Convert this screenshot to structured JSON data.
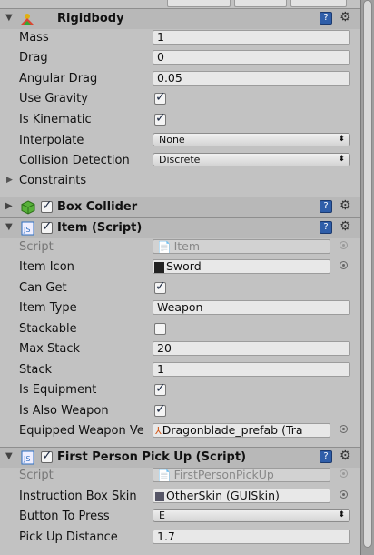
{
  "rigidbody": {
    "title": "Rigidbody",
    "mass_label": "Mass",
    "mass": "1",
    "drag_label": "Drag",
    "drag": "0",
    "angular_drag_label": "Angular Drag",
    "angular_drag": "0.05",
    "use_gravity_label": "Use Gravity",
    "use_gravity": true,
    "is_kinematic_label": "Is Kinematic",
    "is_kinematic": true,
    "interpolate_label": "Interpolate",
    "interpolate": "None",
    "collision_detection_label": "Collision Detection",
    "collision_detection": "Discrete",
    "constraints_label": "Constraints"
  },
  "box_collider": {
    "title": "Box Collider",
    "enabled": true
  },
  "item_script": {
    "title": "Item (Script)",
    "enabled": true,
    "script_label": "Script",
    "script": "Item",
    "item_icon_label": "Item Icon",
    "item_icon": "Sword",
    "can_get_label": "Can Get",
    "can_get": true,
    "item_type_label": "Item Type",
    "item_type": "Weapon",
    "stackable_label": "Stackable",
    "stackable": false,
    "max_stack_label": "Max Stack",
    "max_stack": "20",
    "stack_label": "Stack",
    "stack": "1",
    "is_equipment_label": "Is Equipment",
    "is_equipment": true,
    "is_also_weapon_label": "Is Also Weapon",
    "is_also_weapon": true,
    "equipped_weapon_label": "Equipped Weapon Ve",
    "equipped_weapon": "Dragonblade_prefab (Tra"
  },
  "pickup_script": {
    "title": "First Person Pick Up (Script)",
    "enabled": true,
    "script_label": "Script",
    "script": "FirstPersonPickUp",
    "instruction_skin_label": "Instruction Box Skin",
    "instruction_skin": "OtherSkin (GUISkin)",
    "button_label": "Button To Press",
    "button": "E",
    "distance_label": "Pick Up Distance",
    "distance": "1.7"
  },
  "icons": {
    "fold": "fold-down-icon",
    "help": "help-book-icon",
    "settings": "gear-icon",
    "object_picker": "object-picker-icon"
  },
  "colors": {
    "panel": "#c2c2c2",
    "header": "#b8b8b8",
    "js_icon": "#2f6fc0",
    "collider": "#58b23a"
  }
}
